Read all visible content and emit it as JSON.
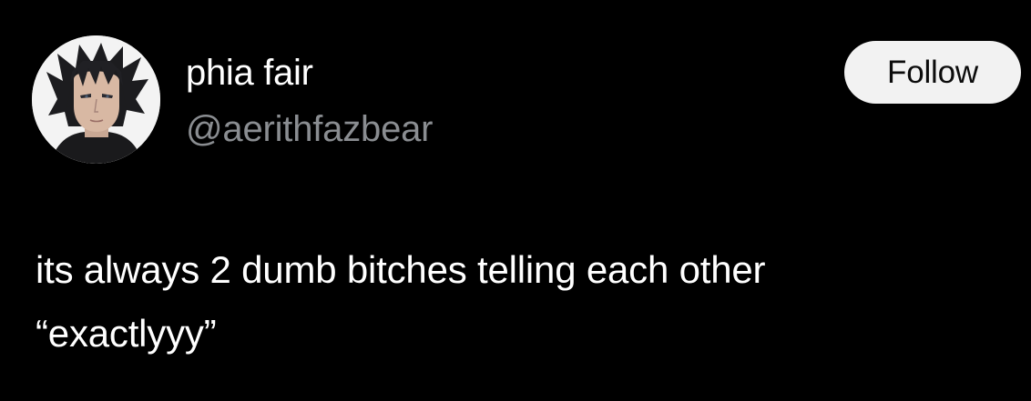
{
  "author": {
    "display_name": "phia fair",
    "handle": "@aerithfazbear",
    "avatar_icon": "profile-avatar-image"
  },
  "actions": {
    "follow_label": "Follow"
  },
  "tweet": {
    "lines": [
      "its always 2 dumb bitches telling each other",
      "“exactlyyy”"
    ]
  },
  "colors": {
    "background": "#000000",
    "text_primary": "#ffffff",
    "text_secondary": "#8a8d91",
    "button_bg": "#f2f2f2",
    "button_text": "#0c0c0c"
  }
}
